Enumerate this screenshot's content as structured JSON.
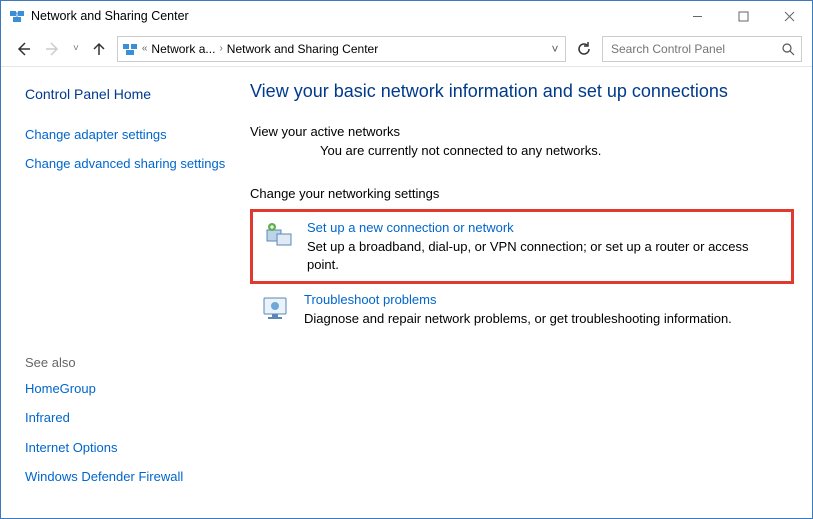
{
  "window": {
    "title": "Network and Sharing Center"
  },
  "breadcrumb": {
    "item1": "Network a...",
    "item2": "Network and Sharing Center"
  },
  "search": {
    "placeholder": "Search Control Panel"
  },
  "sidebar": {
    "home": "Control Panel Home",
    "links": {
      "adapter": "Change adapter settings",
      "advanced": "Change advanced sharing settings"
    },
    "see_also_hdr": "See also",
    "see_also": {
      "homegroup": "HomeGroup",
      "infrared": "Infrared",
      "internet": "Internet Options",
      "firewall": "Windows Defender Firewall"
    }
  },
  "main": {
    "heading": "View your basic network information and set up connections",
    "active_hdr": "View your active networks",
    "active_sub": "You are currently not connected to any networks.",
    "change_hdr": "Change your networking settings",
    "opt1": {
      "title": "Set up a new connection or network",
      "desc": "Set up a broadband, dial-up, or VPN connection; or set up a router or access point."
    },
    "opt2": {
      "title": "Troubleshoot problems",
      "desc": "Diagnose and repair network problems, or get troubleshooting information."
    }
  }
}
